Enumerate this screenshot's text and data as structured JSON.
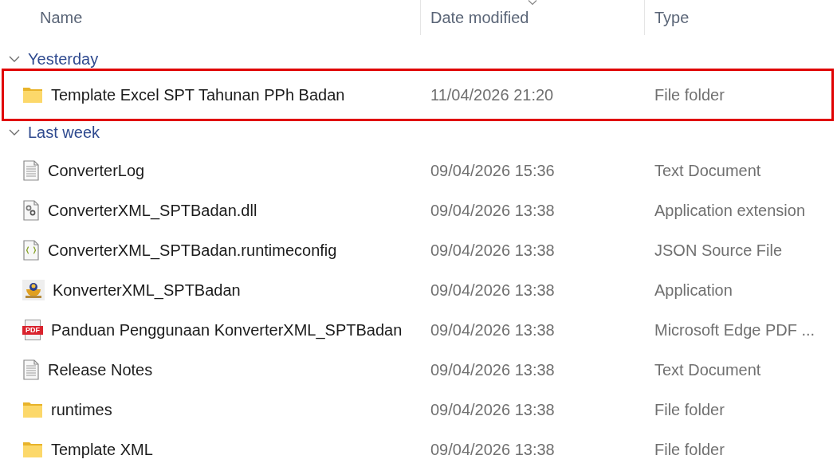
{
  "columns": [
    {
      "label": "Name",
      "sorted": false
    },
    {
      "label": "Date modified",
      "sorted": true
    },
    {
      "label": "Type",
      "sorted": false
    }
  ],
  "groups": [
    {
      "label": "Yesterday",
      "expanded": true,
      "items": [
        {
          "kind": "folder",
          "name": "Template Excel SPT Tahunan PPh Badan",
          "date": "11/04/2026 21:20",
          "type": "File folder",
          "highlighted": true
        }
      ]
    },
    {
      "label": "Last week",
      "expanded": true,
      "items": [
        {
          "kind": "text",
          "name": "ConverterLog",
          "date": "09/04/2026 15:36",
          "type": "Text Document",
          "highlighted": false
        },
        {
          "kind": "dll",
          "name": "ConverterXML_SPTBadan.dll",
          "date": "09/04/2026 13:38",
          "type": "Application extension",
          "highlighted": false
        },
        {
          "kind": "json",
          "name": "ConverterXML_SPTBadan.runtimeconfig",
          "date": "09/04/2026 13:38",
          "type": "JSON Source File",
          "highlighted": false
        },
        {
          "kind": "app",
          "name": "KonverterXML_SPTBadan",
          "date": "09/04/2026 13:38",
          "type": "Application",
          "highlighted": false
        },
        {
          "kind": "pdf",
          "badge": "PDF",
          "name": "Panduan Penggunaan KonverterXML_SPTBadan",
          "date": "09/04/2026 13:38",
          "type": "Microsoft Edge PDF ...",
          "highlighted": false
        },
        {
          "kind": "text",
          "name": "Release Notes",
          "date": "09/04/2026 13:38",
          "type": "Text Document",
          "highlighted": false
        },
        {
          "kind": "folder",
          "name": "runtimes",
          "date": "09/04/2026 13:38",
          "type": "File folder",
          "highlighted": false
        },
        {
          "kind": "folder",
          "name": "Template XML",
          "date": "09/04/2026 13:38",
          "type": "File folder",
          "highlighted": false
        }
      ]
    }
  ]
}
